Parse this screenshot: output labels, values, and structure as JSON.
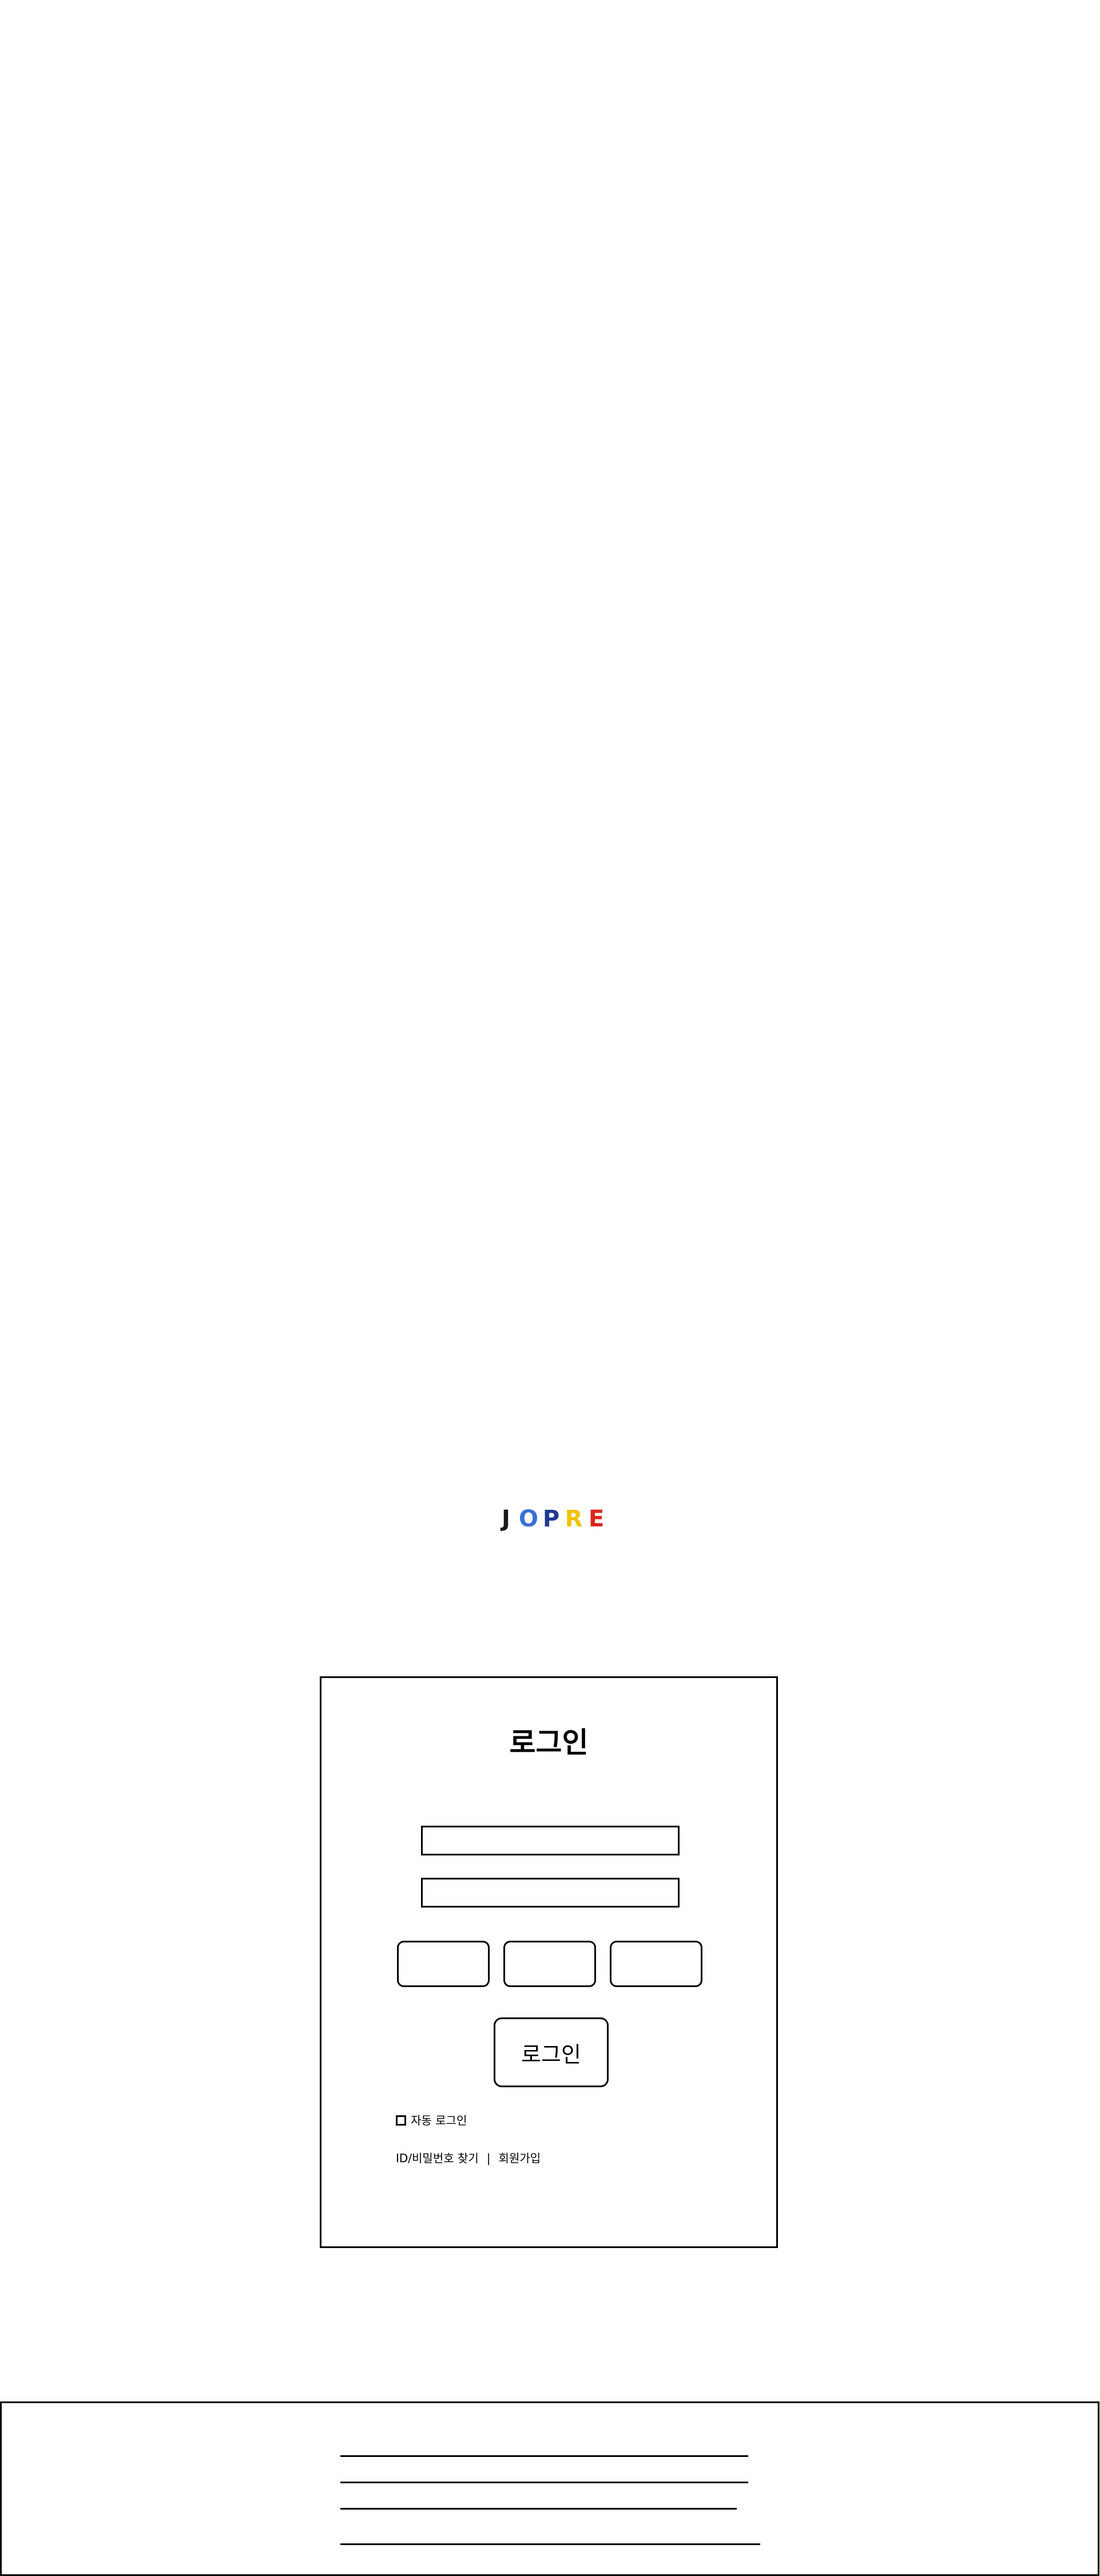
{
  "logo": {
    "letters": [
      {
        "char": "J",
        "color": "#1a1a1a"
      },
      {
        "char": "O",
        "color": "#3b6fd8"
      },
      {
        "char": "P",
        "color": "#1f3a93"
      },
      {
        "char": "R",
        "color": "#f2c200"
      },
      {
        "char": "E",
        "color": "#d9261c"
      }
    ]
  },
  "login": {
    "title": "로그인",
    "id_placeholder": "",
    "password_placeholder": "",
    "submit_label": "로그인",
    "auto_login_label": "자동 로그인",
    "find_account_label": "ID/비밀번호 찾기",
    "separator": "|",
    "signup_label": "회원가입"
  },
  "colors": {
    "border": "#000000",
    "background": "#ffffff"
  }
}
